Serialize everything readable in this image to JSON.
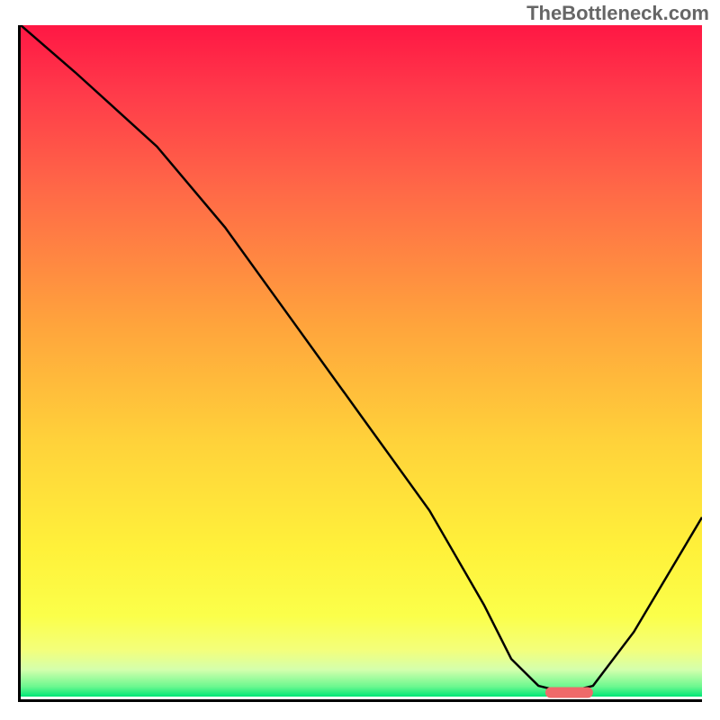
{
  "watermark": "TheBottleneck.com",
  "chart_data": {
    "type": "line",
    "title": "",
    "xlabel": "",
    "ylabel": "",
    "xlim": [
      0,
      100
    ],
    "ylim": [
      0,
      100
    ],
    "grid": false,
    "series": [
      {
        "name": "curve",
        "x": [
          0,
          8,
          20,
          30,
          40,
          50,
          60,
          68,
          72,
          76,
          80,
          84,
          90,
          100
        ],
        "values": [
          100,
          93,
          82,
          70,
          56,
          42,
          28,
          14,
          6,
          2,
          1,
          2,
          10,
          27
        ]
      }
    ],
    "annotations": [
      {
        "name": "min-marker",
        "type": "pill",
        "x0": 77,
        "x1": 84,
        "y": 1.0,
        "color": "#ef6a6a"
      }
    ],
    "background": {
      "type": "vertical-gradient",
      "stops": [
        {
          "pos": 0.0,
          "color": "#ff1744"
        },
        {
          "pos": 0.1,
          "color": "#ff3a4a"
        },
        {
          "pos": 0.25,
          "color": "#ff6a47"
        },
        {
          "pos": 0.45,
          "color": "#ffa53c"
        },
        {
          "pos": 0.62,
          "color": "#ffd23a"
        },
        {
          "pos": 0.78,
          "color": "#fff13a"
        },
        {
          "pos": 0.88,
          "color": "#fbff4a"
        },
        {
          "pos": 0.93,
          "color": "#f4ff7a"
        },
        {
          "pos": 0.96,
          "color": "#d4ffad"
        },
        {
          "pos": 0.985,
          "color": "#6cf88f"
        },
        {
          "pos": 1.0,
          "color": "#00e676"
        }
      ]
    }
  }
}
